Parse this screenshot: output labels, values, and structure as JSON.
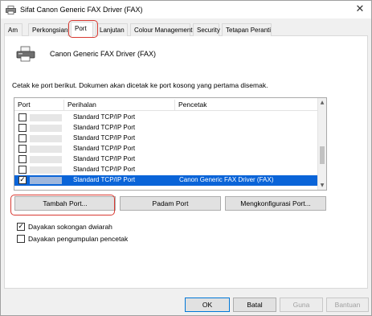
{
  "window": {
    "title": "Sifat Canon Generic FAX Driver (FAX)",
    "close_glyph": "✕"
  },
  "tabs": [
    {
      "label": "Am"
    },
    {
      "label": "Perkongsian"
    },
    {
      "label": "Port",
      "active": true
    },
    {
      "label": "Lanjutan"
    },
    {
      "label": "Colour Management"
    },
    {
      "label": "Security"
    },
    {
      "label": "Tetapan Peranti"
    }
  ],
  "printer": {
    "name": "Canon Generic FAX Driver (FAX)",
    "icon": "printer-icon"
  },
  "hint": "Cetak ke port berikut. Dokumen akan dicetak ke port kosong yang pertama disemak.",
  "list": {
    "columns": [
      "Port",
      "Perihalan",
      "Pencetak"
    ],
    "rows": [
      {
        "checked": false,
        "description": "Standard TCP/IP Port",
        "printer": ""
      },
      {
        "checked": false,
        "description": "Standard TCP/IP Port",
        "printer": ""
      },
      {
        "checked": false,
        "description": "Standard TCP/IP Port",
        "printer": ""
      },
      {
        "checked": false,
        "description": "Standard TCP/IP Port",
        "printer": ""
      },
      {
        "checked": false,
        "description": "Standard TCP/IP Port",
        "printer": ""
      },
      {
        "checked": false,
        "description": "Standard TCP/IP Port",
        "printer": ""
      },
      {
        "checked": true,
        "selected": true,
        "description": "Standard TCP/IP Port",
        "printer": "Canon Generic FAX Driver (FAX)"
      }
    ],
    "check_glyph": "✓",
    "scroll_up": "▲",
    "scroll_down": "▼"
  },
  "port_buttons": {
    "add": "Tambah Port...",
    "delete": "Padam Port",
    "configure": "Mengkonfigurasi Port..."
  },
  "options": {
    "bidirectional": {
      "label": "Dayakan sokongan dwiarah",
      "checked": true
    },
    "pooling": {
      "label": "Dayakan pengumpulan pencetak",
      "checked": false
    }
  },
  "footer": {
    "ok": "OK",
    "cancel": "Batal",
    "apply": "Guna",
    "help": "Bantuan"
  },
  "colors": {
    "highlight": "#d83a32",
    "selection": "#0a64d8"
  }
}
